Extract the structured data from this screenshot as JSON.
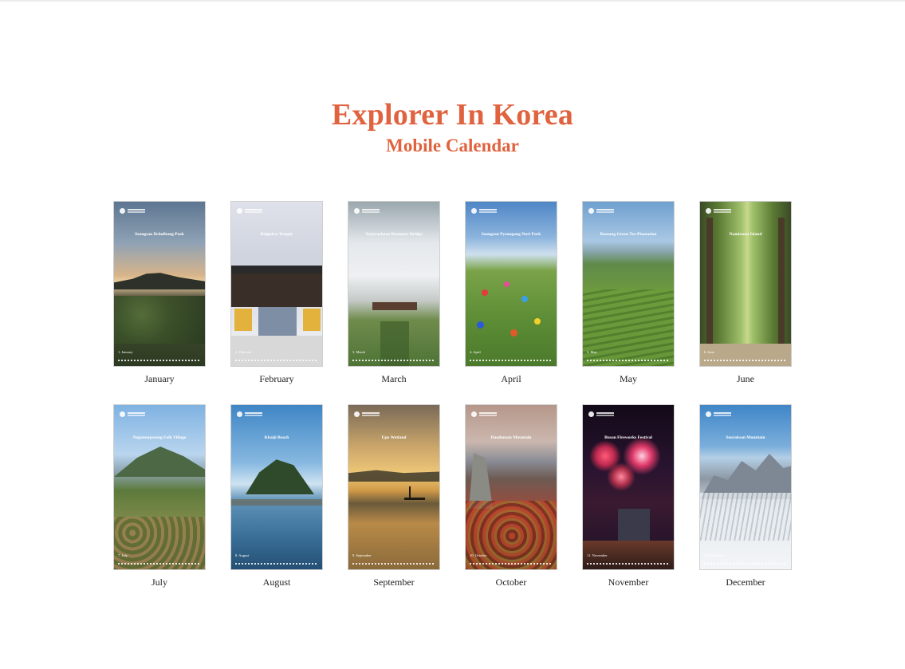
{
  "title": "Explorer In Korea",
  "subtitle": "Mobile Calendar",
  "months": [
    {
      "name": "January",
      "place": "Seongsan Ilchulbong Peak",
      "label": "1. January"
    },
    {
      "name": "February",
      "place": "Bulguksa Temple",
      "label": "2. February"
    },
    {
      "name": "March",
      "place": "Yeojwacheon Romance Bridge",
      "label": "3. March"
    },
    {
      "name": "April",
      "place": "Seongsan Pyeongang Nuri Park",
      "label": "4. April"
    },
    {
      "name": "May",
      "place": "Boseong Green Tea Plantation",
      "label": "5. May"
    },
    {
      "name": "June",
      "place": "Namiseom Island",
      "label": "6. June"
    },
    {
      "name": "July",
      "place": "Naganeupseong Folk Village",
      "label": "7. July"
    },
    {
      "name": "August",
      "place": "Khaiji Beach",
      "label": "8. August"
    },
    {
      "name": "September",
      "place": "Upo Wetland",
      "label": "9. September"
    },
    {
      "name": "October",
      "place": "Daedunsan Mountain",
      "label": "10. October"
    },
    {
      "name": "November",
      "place": "Busan Fireworks Festival",
      "label": "11. November"
    },
    {
      "name": "December",
      "place": "Seoraksan Mountain",
      "label": "12. December"
    }
  ],
  "colors": {
    "accent": "#e0623e"
  }
}
